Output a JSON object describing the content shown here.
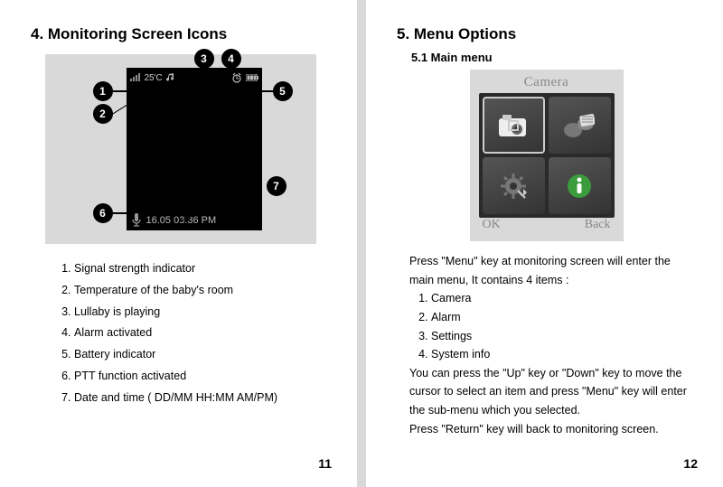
{
  "left": {
    "title": "4. Monitoring Screen Icons",
    "page_number": "11",
    "status": {
      "temperature": "25'C",
      "datetime": "16.05 03:36 PM"
    },
    "callouts": [
      "1",
      "2",
      "3",
      "4",
      "5",
      "6",
      "7"
    ],
    "legend": [
      "Signal strength indicator",
      "Temperature of the baby's room",
      "Lullaby is playing",
      "Alarm activated",
      "Battery indicator",
      "PTT function activated",
      "Date and time ( DD/MM HH:MM AM/PM)"
    ]
  },
  "right": {
    "title": "5. Menu Options",
    "subtitle": "5.1 Main menu",
    "page_number": "12",
    "menu": {
      "title": "Camera",
      "ok": "OK",
      "back": "Back"
    },
    "intro": "Press \"Menu\" key at monitoring screen will enter the main menu, It contains 4 items :",
    "items": [
      "Camera",
      "Alarm",
      "Settings",
      "System info"
    ],
    "para2": "You can press the \"Up\" key or \"Down\" key to move the cursor to select an item and press \"Menu\" key will enter the sub-menu which you selected.",
    "para3": "Press \"Return\" key will back to monitoring screen."
  }
}
